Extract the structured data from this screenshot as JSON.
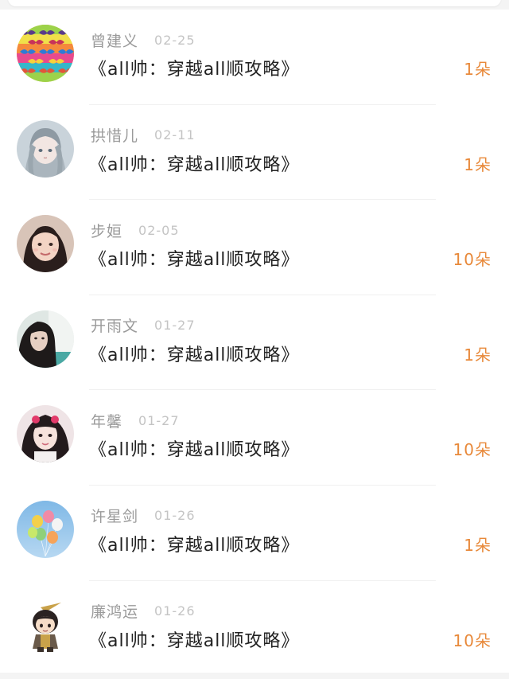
{
  "gift_list": {
    "items": [
      {
        "name": "曾建义",
        "date": "02-25",
        "title": "《all帅：穿越all顺攻略》",
        "amount": "1朵",
        "avatar_icon": "mustache-pattern-avatar"
      },
      {
        "name": "拱惜儿",
        "date": "02-11",
        "title": "《all帅：穿越all顺攻略》",
        "amount": "1朵",
        "avatar_icon": "anime-girl-avatar"
      },
      {
        "name": "步姮",
        "date": "02-05",
        "title": "《all帅：穿越all顺攻略》",
        "amount": "10朵",
        "avatar_icon": "girl-selfie-avatar"
      },
      {
        "name": "开雨文",
        "date": "01-27",
        "title": "《all帅：穿越all顺攻略》",
        "amount": "1朵",
        "avatar_icon": "woman-portrait-avatar"
      },
      {
        "name": "年馨",
        "date": "01-27",
        "title": "《all帅：穿越all顺攻略》",
        "amount": "10朵",
        "avatar_icon": "girl-photo-avatar"
      },
      {
        "name": "许星剑",
        "date": "01-26",
        "title": "《all帅：穿越all顺攻略》",
        "amount": "1朵",
        "avatar_icon": "balloons-avatar"
      },
      {
        "name": "廉鸿运",
        "date": "01-26",
        "title": "《all帅：穿越all顺攻略》",
        "amount": "10朵",
        "avatar_icon": "cartoon-warrior-avatar"
      }
    ]
  },
  "colors": {
    "amount": "#e8893a",
    "name": "#9a9a9a",
    "date": "#c4c4c4",
    "title": "#222222"
  }
}
